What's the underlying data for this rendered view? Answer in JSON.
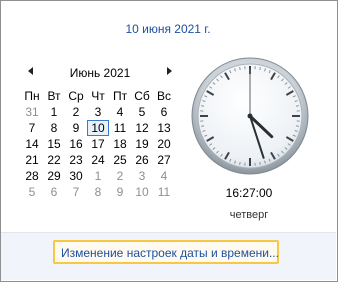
{
  "header": {
    "date_title": "10 июня 2021 г."
  },
  "calendar": {
    "month_label": "Июнь 2021",
    "weekdays": [
      "Пн",
      "Вт",
      "Ср",
      "Чт",
      "Пт",
      "Сб",
      "Вс"
    ],
    "weeks": [
      [
        "31",
        "1",
        "2",
        "3",
        "4",
        "5",
        "6"
      ],
      [
        "7",
        "8",
        "9",
        "10",
        "11",
        "12",
        "13"
      ],
      [
        "14",
        "15",
        "16",
        "17",
        "18",
        "19",
        "20"
      ],
      [
        "21",
        "22",
        "23",
        "24",
        "25",
        "26",
        "27"
      ],
      [
        "28",
        "29",
        "30",
        "1",
        "2",
        "3",
        "4"
      ],
      [
        "5",
        "6",
        "7",
        "8",
        "9",
        "10",
        "11"
      ]
    ],
    "muted": [
      [
        true,
        false,
        false,
        false,
        false,
        false,
        false
      ],
      [
        false,
        false,
        false,
        false,
        false,
        false,
        false
      ],
      [
        false,
        false,
        false,
        false,
        false,
        false,
        false
      ],
      [
        false,
        false,
        false,
        false,
        false,
        false,
        false
      ],
      [
        false,
        false,
        false,
        true,
        true,
        true,
        true
      ],
      [
        true,
        true,
        true,
        true,
        true,
        true,
        true
      ]
    ],
    "selected_day": "10"
  },
  "clock": {
    "hours": 16,
    "minutes": 27,
    "seconds": 0,
    "time_text": "16:27:00",
    "day_text": "четверг"
  },
  "footer": {
    "link_label": "Изменение настроек даты и времени..."
  },
  "colors": {
    "link": "#1e50a2",
    "focus_border": "#f7c843",
    "today_border": "#3a79c6"
  }
}
